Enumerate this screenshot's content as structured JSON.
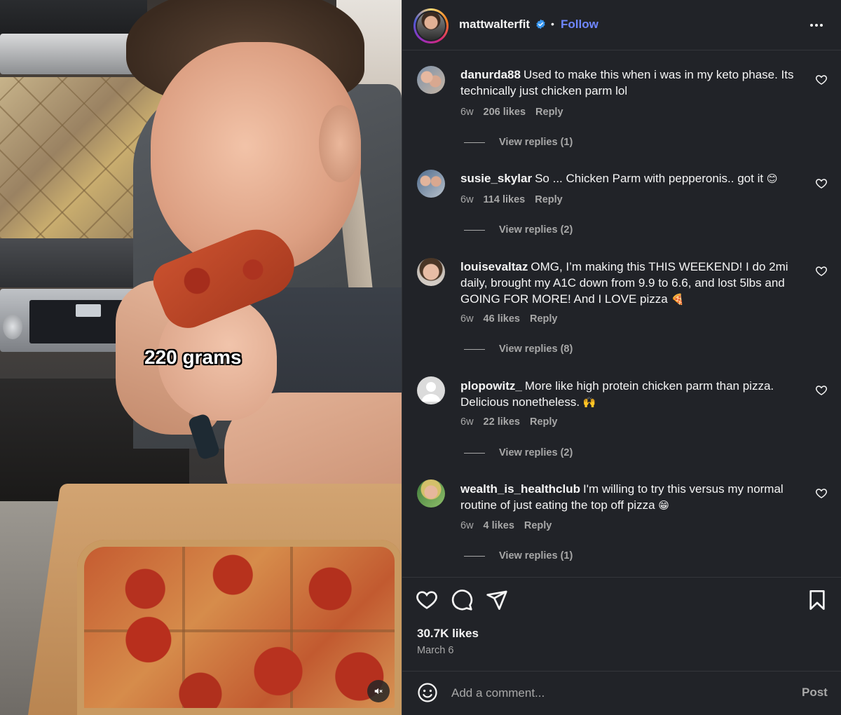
{
  "media": {
    "overlay_caption": "220 grams",
    "mute_icon": "speaker-muted-icon"
  },
  "header": {
    "username": "mattwalterfit",
    "verified": true,
    "separator": "•",
    "follow_label": "Follow",
    "more_icon": "more-dots-icon"
  },
  "comments": [
    {
      "username": "danurda88",
      "text": "Used to make this when i was in my keto phase. Its technically just chicken parm lol",
      "emoji": "",
      "time": "6w",
      "likes": "206 likes",
      "reply_label": "Reply",
      "view_replies": "View replies (1)"
    },
    {
      "username": "susie_skylar",
      "text": "So ... Chicken Parm with pepperonis.. got it",
      "emoji": "😊",
      "time": "6w",
      "likes": "114 likes",
      "reply_label": "Reply",
      "view_replies": "View replies (2)"
    },
    {
      "username": "louisevaltaz",
      "text": "OMG, I’m making this THIS WEEKEND! I do 2mi daily, brought my A1C down from 9.9 to 6.6, and lost 5lbs and GOING FOR MORE! And I LOVE pizza",
      "emoji": "🍕",
      "time": "6w",
      "likes": "46 likes",
      "reply_label": "Reply",
      "view_replies": "View replies (8)"
    },
    {
      "username": "plopowitz_",
      "text": "More like high protein chicken parm than pizza. Delicious nonetheless.",
      "emoji": "🙌",
      "time": "6w",
      "likes": "22 likes",
      "reply_label": "Reply",
      "view_replies": "View replies (2)"
    },
    {
      "username": "wealth_is_healthclub",
      "text": "I'm willing to try this versus my normal routine of just eating the top off pizza",
      "emoji": "😁",
      "time": "6w",
      "likes": "4 likes",
      "reply_label": "Reply",
      "view_replies": "View replies (1)"
    }
  ],
  "actions": {
    "like_icon": "heart-outline-icon",
    "comment_icon": "comment-bubble-icon",
    "share_icon": "paper-plane-icon",
    "save_icon": "bookmark-icon",
    "likes_count": "30.7K likes",
    "post_date": "March 6"
  },
  "add_comment": {
    "emoji_icon": "smiley-icon",
    "placeholder": "Add a comment...",
    "post_label": "Post"
  },
  "colors": {
    "panel_bg": "#212328",
    "link_blue": "#6f87ff",
    "secondary_text": "#a8a8a8",
    "verified_blue": "#3897f0"
  }
}
